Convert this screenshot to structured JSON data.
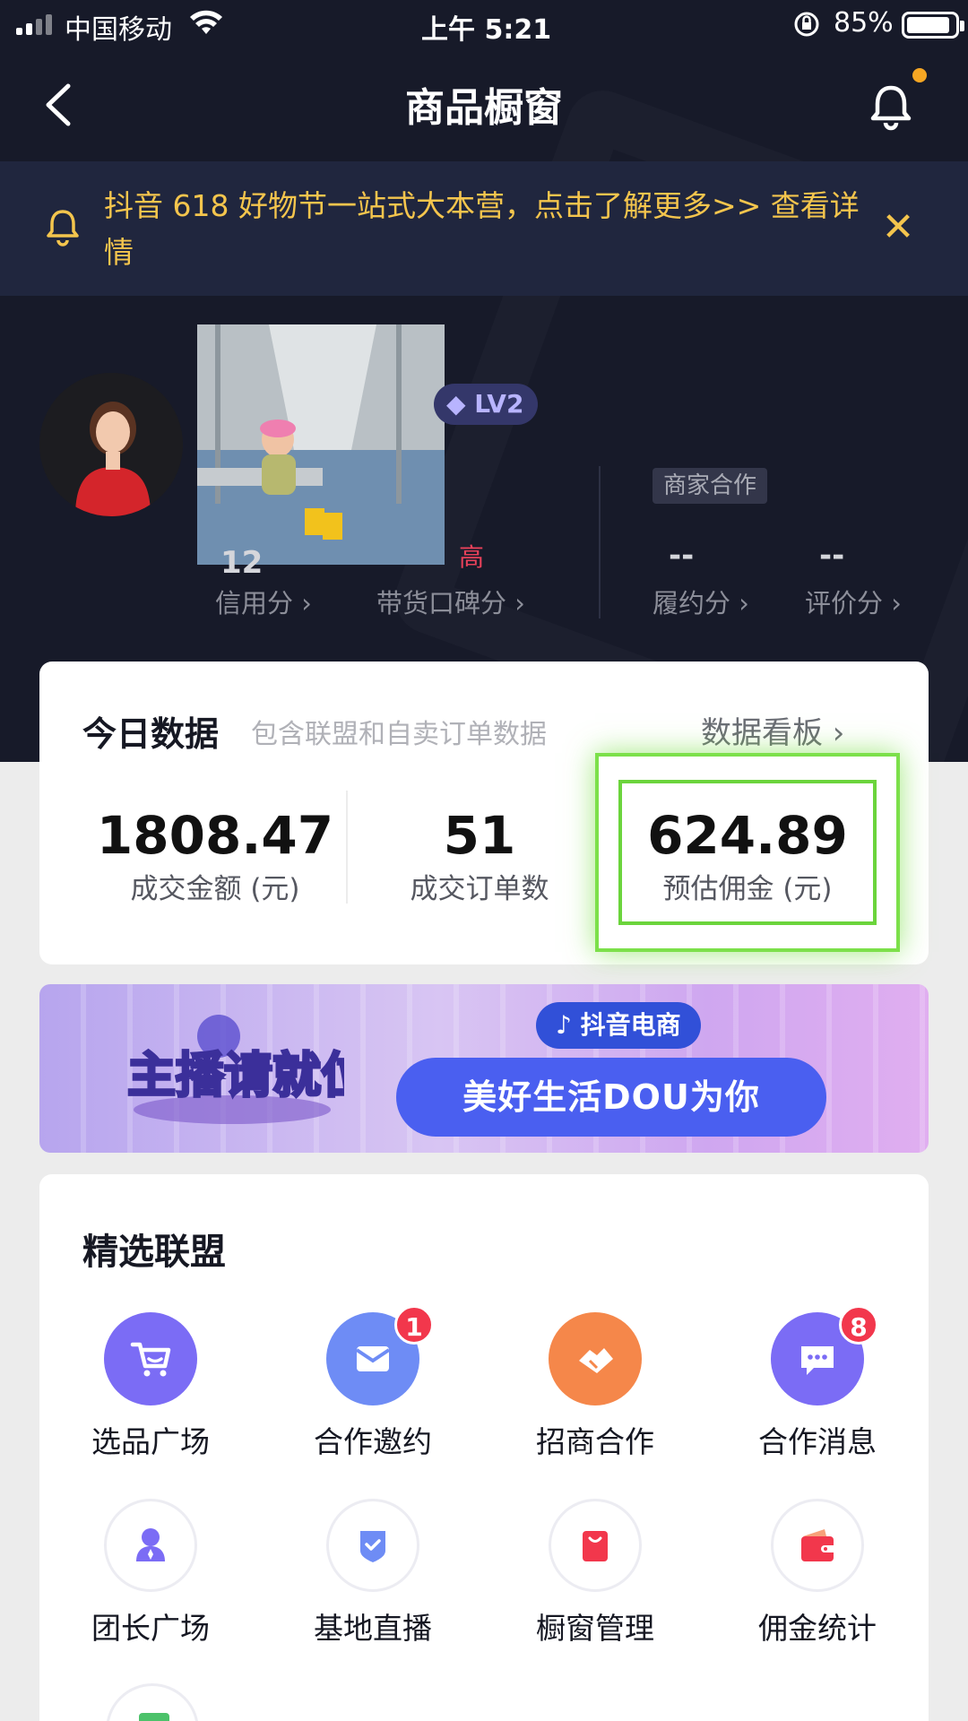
{
  "status_bar": {
    "carrier": "中国移动",
    "time": "上午 5:21",
    "battery": "85%"
  },
  "nav": {
    "title": "商品橱窗"
  },
  "notice": {
    "text": "抖音 618 好物节一站式大本营，点击了解更多>> 查看详情"
  },
  "profile": {
    "level": "LV2",
    "merchant_tag": "商家合作",
    "credit_score_value": "12",
    "reputation_value": "高",
    "fulfillment_value": "--",
    "review_value": "--",
    "labels": {
      "credit": "信用分 ›",
      "reputation": "带货口碑分 ›",
      "fulfillment": "履约分 ›",
      "review": "评价分 ›"
    }
  },
  "today": {
    "title": "今日数据",
    "subtitle": "包含联盟和自卖订单数据",
    "dashboard_link": "数据看板 ›",
    "stats": [
      {
        "value": "1808.47",
        "label": "成交金额 (元)"
      },
      {
        "value": "51",
        "label": "成交订单数"
      },
      {
        "value": "624.89",
        "label": "预估佣金 (元)"
      }
    ]
  },
  "banner": {
    "logo_text": "主播请就位",
    "brand": "抖音电商",
    "slogan": "美好生活DOU为你"
  },
  "alliance": {
    "title": "精选联盟",
    "items": [
      {
        "label": "选品广场",
        "icon": "cart-icon",
        "color": "#7b6cf5"
      },
      {
        "label": "合作邀约",
        "icon": "mail-icon",
        "color": "#6e8cf5",
        "badge": "1"
      },
      {
        "label": "招商合作",
        "icon": "handshake-icon",
        "color": "#f5874a"
      },
      {
        "label": "合作消息",
        "icon": "chat-icon",
        "color": "#7b6cf5",
        "badge": "8"
      },
      {
        "label": "团长广场",
        "icon": "person-icon",
        "color": "#7b6cf5"
      },
      {
        "label": "基地直播",
        "icon": "shield-icon",
        "color": "#6e8cf5"
      },
      {
        "label": "橱窗管理",
        "icon": "bag-icon",
        "color": "#f2374c"
      },
      {
        "label": "佣金统计",
        "icon": "wallet-icon",
        "color": "#f2374c"
      }
    ]
  }
}
